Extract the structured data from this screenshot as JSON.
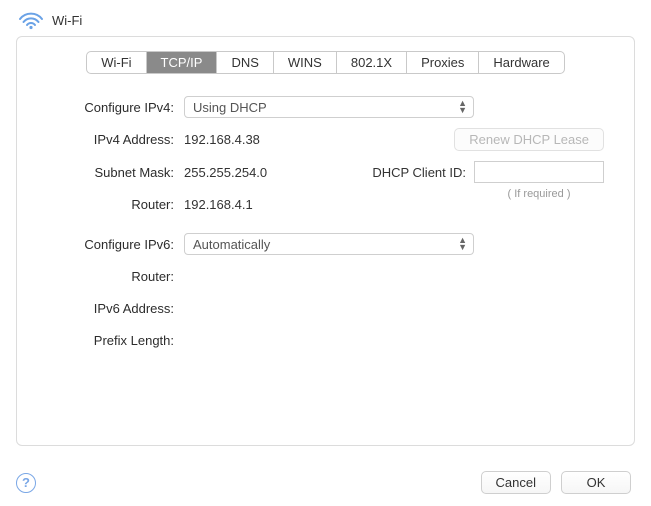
{
  "header": {
    "title": "Wi-Fi"
  },
  "tabs": {
    "items": [
      "Wi-Fi",
      "TCP/IP",
      "DNS",
      "WINS",
      "802.1X",
      "Proxies",
      "Hardware"
    ],
    "active_index": 1
  },
  "ipv4": {
    "configure_label": "Configure IPv4:",
    "configure_value": "Using DHCP",
    "address_label": "IPv4 Address:",
    "address_value": "192.168.4.38",
    "subnet_label": "Subnet Mask:",
    "subnet_value": "255.255.254.0",
    "router_label": "Router:",
    "router_value": "192.168.4.1",
    "renew_button": "Renew DHCP Lease",
    "dhcp_client_label": "DHCP Client ID:",
    "dhcp_client_value": "",
    "if_required": "( If required )"
  },
  "ipv6": {
    "configure_label": "Configure IPv6:",
    "configure_value": "Automatically",
    "router_label": "Router:",
    "router_value": "",
    "address_label": "IPv6 Address:",
    "address_value": "",
    "prefix_label": "Prefix Length:",
    "prefix_value": ""
  },
  "footer": {
    "help": "?",
    "cancel": "Cancel",
    "ok": "OK"
  }
}
